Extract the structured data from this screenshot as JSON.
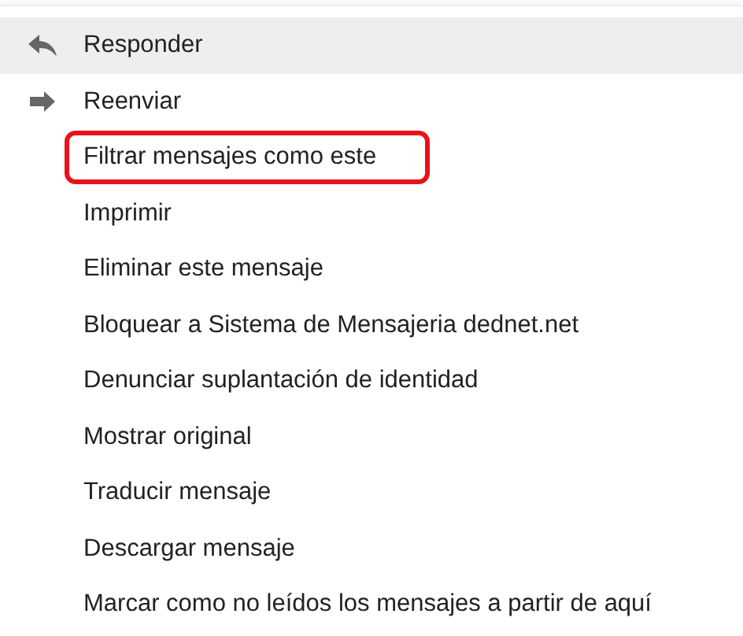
{
  "menu": {
    "items": [
      {
        "label": "Responder",
        "kind": "reply",
        "selected": true,
        "outlined": false
      },
      {
        "label": "Reenviar",
        "kind": "forward",
        "selected": false,
        "outlined": false
      },
      {
        "label": "Filtrar mensajes como este",
        "selected": false,
        "outlined": true
      },
      {
        "label": "Imprimir",
        "selected": false,
        "outlined": false
      },
      {
        "label": "Eliminar este mensaje",
        "selected": false,
        "outlined": false
      },
      {
        "label": "Bloquear a Sistema de Mensajeria dednet.net",
        "selected": false,
        "outlined": false
      },
      {
        "label": "Denunciar suplantación de identidad",
        "selected": false,
        "outlined": false
      },
      {
        "label": "Mostrar original",
        "selected": false,
        "outlined": false
      },
      {
        "label": "Traducir mensaje",
        "selected": false,
        "outlined": false
      },
      {
        "label": "Descargar mensaje",
        "selected": false,
        "outlined": false
      },
      {
        "label": "Marcar como no leídos los mensajes a partir de aquí",
        "selected": false,
        "outlined": false
      }
    ]
  }
}
